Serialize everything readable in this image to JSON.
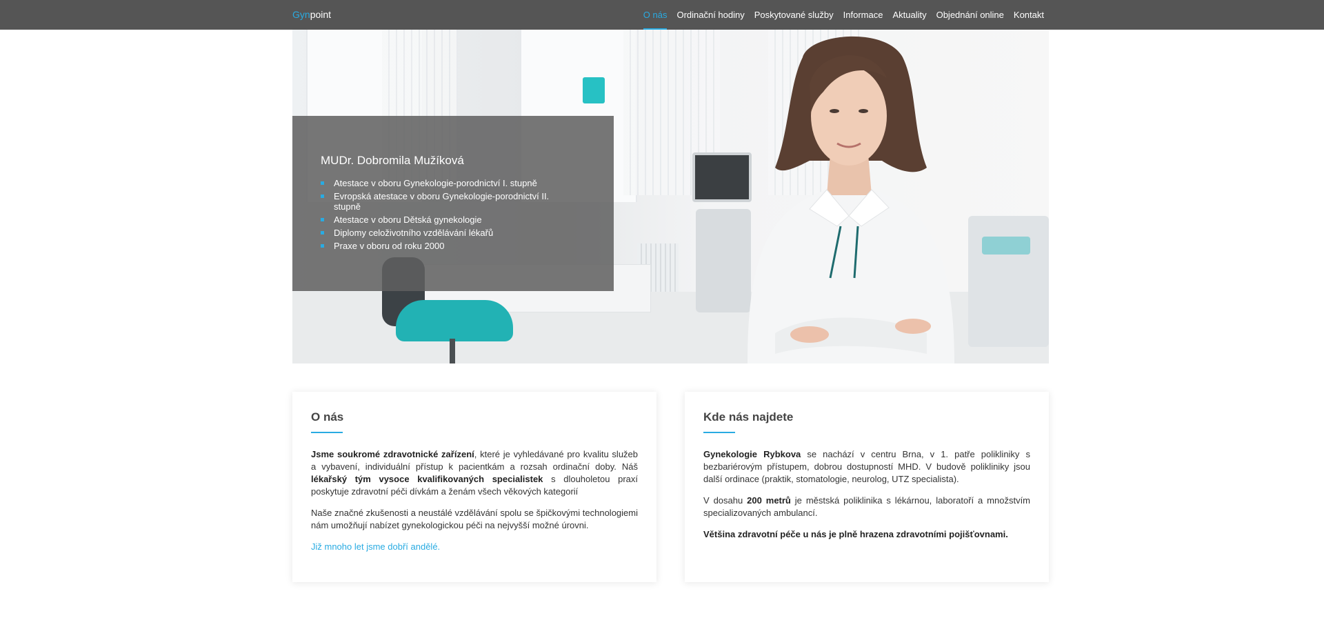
{
  "brand": {
    "part1": "Gyn",
    "part2": "point"
  },
  "nav": {
    "items": [
      "O nás",
      "Ordinační hodiny",
      "Poskytované služby",
      "Informace",
      "Aktuality",
      "Objednání online",
      "Kontakt"
    ],
    "active": "O nás"
  },
  "hero": {
    "name": "MUDr. Dobromila Mužíková",
    "qualifications": [
      "Atestace v oboru Gynekologie-porodnictví I. stupně",
      "Evropská atestace v oboru Gynekologie-porodnictví II. stupně",
      "Atestace v oboru Dětská gynekologie",
      "Diplomy celoživotního vzdělávání lékařů",
      "Praxe v oboru od roku 2000"
    ]
  },
  "about": {
    "title": "O nás",
    "p1": {
      "b1": "Jsme soukromé zdravotnické zařízení",
      "t1": ", které je vyhledávané pro kvalitu služeb a vybavení, individuální přístup k pacientkám a rozsah ordinační doby. Náš ",
      "b2": "lékařský tým vysoce kvalifikovaných specialistek",
      "t2": " s dlouholetou praxí poskytuje zdravotní péči dívkám a ženám všech věkových kategorií"
    },
    "p2": "Naše značné zkušenosti a neustálé vzdělávání spolu se špičkovými technologiemi nám umožňují nabízet gynekologickou péči na nejvyšší možné úrovni.",
    "link": "Již mnoho let jsme dobří andělé."
  },
  "location": {
    "title": "Kde nás najdete",
    "p1": {
      "b1": "Gynekologie Rybkova",
      "t1": " se nachází v centru Brna, v 1. patře polikliniky s bezbariérovým přístupem, dobrou dostupností MHD. V budově polikliniky jsou další ordinace (praktik, stomatologie, neurolog, UTZ specialista)."
    },
    "p2": {
      "t0": "V dosahu ",
      "b1": "200 metrů",
      "t1": " je městská poliklinika s lékárnou, laboratoří a množstvím specializovaných ambulancí."
    },
    "p3": "Většina zdravotní péče u nás je plně hrazena zdravotními pojišťovnami."
  },
  "colors": {
    "accent": "#29abe2",
    "navbar": "#555555",
    "overlay": "#5f5f5f"
  }
}
